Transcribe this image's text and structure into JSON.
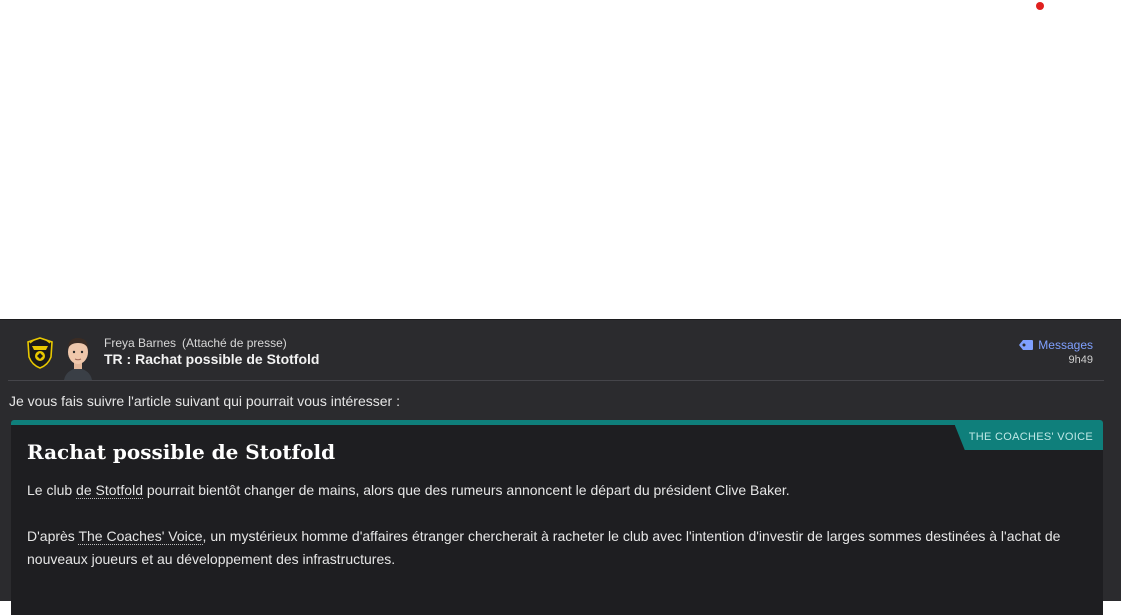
{
  "message": {
    "sender_name": "Freya Barnes",
    "sender_role": "(Attaché de presse)",
    "subject": "TR : Rachat possible de Stotfold",
    "messages_link": "Messages",
    "time": "9h49",
    "intro": "Je vous fais suivre l'article suivant qui pourrait vous intéresser :"
  },
  "article": {
    "source": "THE COACHES' VOICE",
    "title": "Rachat possible de Stotfold",
    "p1_pre": "Le club ",
    "p1_link": "de Stotfold",
    "p1_post": " pourrait bientôt changer de mains, alors que des rumeurs annoncent le départ du président Clive Baker.",
    "p2_pre": "D'après ",
    "p2_link": "The Coaches' Voice",
    "p2_post": ", un mystérieux homme d'affaires étranger chercherait à racheter le club avec l'intention d'investir de larges sommes destinées à l'achat de nouveaux joueurs et au développement des infrastructures."
  },
  "colors": {
    "accent_teal": "#0f7f7b",
    "link_blue": "#7fa0ff",
    "notification_red": "#e0201e"
  },
  "icons": {
    "club_logo": "club-crest-icon",
    "avatar": "staff-avatar",
    "messages": "tag-icon",
    "notification": "notification-dot-icon"
  }
}
